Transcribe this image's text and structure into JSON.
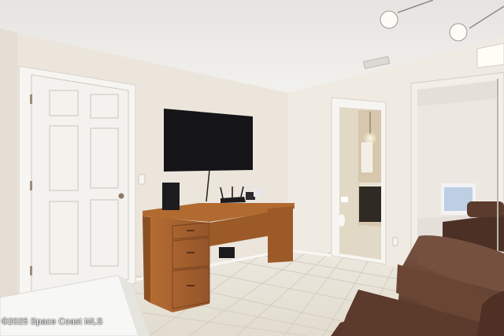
{
  "watermark": "©2025 Space Coast MLS",
  "colors": {
    "wall": "#ece6dd",
    "ceiling": "#efeeec",
    "floor_tile": "#e7e2d6",
    "desk_wood": "#a6602b",
    "sofa": "#6b4636",
    "tv": "#16161a",
    "door": "#f3f2ef"
  }
}
